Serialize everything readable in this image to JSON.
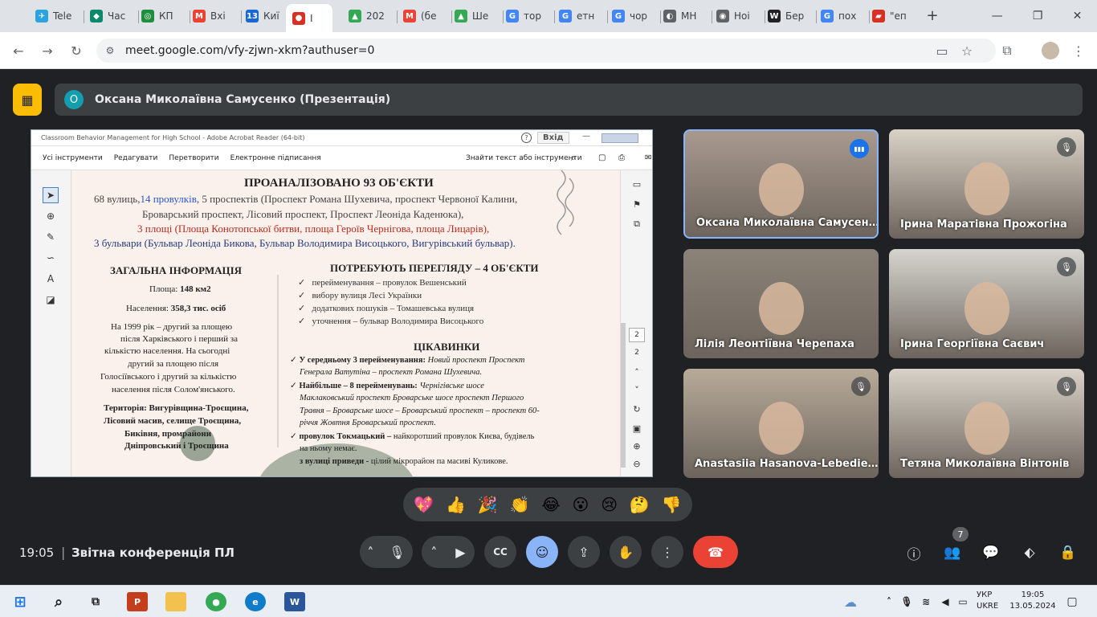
{
  "browser": {
    "tabs": [
      {
        "label": "Tele",
        "color": "#2aa3de",
        "glyph": "✈"
      },
      {
        "label": "Час",
        "color": "#0a8a6a",
        "glyph": "◆"
      },
      {
        "label": "КП",
        "color": "#1e8e3e",
        "glyph": "◎"
      },
      {
        "label": "Вхі",
        "color": "#ea4335",
        "glyph": "M"
      },
      {
        "label": "Киї",
        "color": "#1967d2",
        "glyph": "13"
      },
      {
        "label": "Ⅰ",
        "color": "#d93025",
        "glyph": "●"
      },
      {
        "label": "202",
        "color": "#34a853",
        "glyph": "▲"
      },
      {
        "label": "(бе",
        "color": "#ea4335",
        "glyph": "M"
      },
      {
        "label": "Ше",
        "color": "#34a853",
        "glyph": "▲"
      },
      {
        "label": "тор",
        "color": "#4285f4",
        "glyph": "G"
      },
      {
        "label": "етн",
        "color": "#4285f4",
        "glyph": "G"
      },
      {
        "label": "чор",
        "color": "#4285f4",
        "glyph": "G"
      },
      {
        "label": "МН",
        "color": "#5f6368",
        "glyph": "◐"
      },
      {
        "label": "Ноі",
        "color": "#5f6368",
        "glyph": "◉"
      },
      {
        "label": "Бер",
        "color": "#202124",
        "glyph": "W"
      },
      {
        "label": "пох",
        "color": "#4285f4",
        "glyph": "G"
      },
      {
        "label": "\"еп",
        "color": "#d93025",
        "glyph": "▰"
      }
    ],
    "url": "meet.google.com/vfy-zjwn-xkm?authuser=0"
  },
  "meet": {
    "presenter_initial": "О",
    "presenter": "Оксана Миколаївна Самусенко (Презентація)",
    "clock": "19:05",
    "separator": "|",
    "conference_name": "Звітна конференція ПЛ",
    "participants_count": "7",
    "participants": [
      {
        "name": "Оксана Миколаївна Самусен…",
        "bg": "#a8998e"
      },
      {
        "name": "Ірина Маратівна Прожогіна",
        "bg": "#d9d2c6"
      },
      {
        "name": "Лілія Леонтіївна Черепаха",
        "bg": "#8b8278"
      },
      {
        "name": "Ірина Георгіївна Саєвич",
        "bg": "#d6d4cf"
      },
      {
        "name": "Anastasiia Hasanova-Lebedie…",
        "bg": "#b7aa98"
      },
      {
        "name": "Тетяна Миколаївна Вінтонів",
        "bg": "#d8d2c8"
      }
    ],
    "reactions": [
      "💖",
      "👍",
      "🎉",
      "👏",
      "😂",
      "😮",
      "😢",
      "🤔",
      "👎"
    ]
  },
  "acrobat": {
    "title": "Classroom Behavior Management for High School - Adobe Acrobat Reader (64-bit)",
    "help": "?",
    "signin": "Вхід",
    "menu": [
      "Усі інструменти",
      "Редагувати",
      "Перетворити",
      "Електронне підписання"
    ],
    "search": "Знайти текст або інструменти",
    "page_num": "2",
    "page_total": "2"
  },
  "slide": {
    "heading": "ПРОАНАЛІЗОВАНО 93 ОБ'ЄКТИ",
    "line1a": "68 вулиць,",
    "line1b": "14 провулків",
    "line1c": ", 5 проспектів (Проспект Романа Шухевича,  проспект Червоної Калини,",
    "line2": "Броварський проспект, Лісовий проспект, Проспект Леоніда Каденюка),",
    "line3": "3 площі (Площа Конотопської битви, площа Героїв Чернігова, площа Лицарів),",
    "line4": "3 бульвари (Бульвар Леоніда Бикова, Бульвар Володимира Висоцького, Вигурівський бульвар).",
    "general_title": "ЗАГАЛЬНА ІНФОРМАЦІЯ",
    "area_label": "Площа: ",
    "area": "148 км2",
    "pop_label": "Населення: ",
    "pop": "358,3 тис. осіб",
    "g1": "На 1999 рік – другий за площею",
    "g2": "після Харківського і перший за",
    "g3": "кількістю населення. На сьогодні",
    "g4": "другий за площею після",
    "g5": "Голосіївського і другий за кількістю",
    "g6": "населення після Солом'янського.",
    "t1": "Територія: Вигурівщина-Троєщина,",
    "t2": "Лісовий масив, селище Троєщина,",
    "t3": "Биківня, промрайони",
    "t4": "Дніпровський і Троєщина",
    "review_title": "ПОТРЕБУЮТЬ ПЕРЕГЛЯДУ – 4 ОБ'ЄКТИ",
    "r1": "перейменування – провулок Вешенський",
    "r2": "вибору    вулиця Лесі Українки",
    "r3": "додаткових пошуків – Томашевська вулиця",
    "r4": "уточнення – бульвар Володимира Висоцького",
    "facts_title": "ЦІКАВИНКИ",
    "f1a": "У середньому 3 перейменування: ",
    "f1b": "Новий проспект     Проспект",
    "f1c": "Генерала Ватутіна –  проспект Романа Шухевича.",
    "f2a": "Найбільше   –   8   перейменувань: ",
    "f2b": "Чернігівське    шосе",
    "f2c": "Маклаковський проспект    Броварське шосе    проспект Першого",
    "f2d": "Травня – Броварське шосе –  Броварський проспект – проспект 60-",
    "f2e": "річчя Жовтня    Броварський проспект.",
    "f3a": "провулок Токмацький – ",
    "f3b": "  найкоротший провулок Києва, будівель",
    "f3c": "на ньому немає.",
    "f4a": "з вулиці приведи - ",
    "f4b": "цілий мікрорайон па масиві Куликове."
  },
  "taskbar": {
    "lang1": "УКР",
    "lang2": "UKRE",
    "time": "19:05",
    "date": "13.05.2024"
  },
  "colors": {
    "accent": "#8ab4f8",
    "end_call": "#ea4335",
    "presentation_badge": "#fbbc04"
  }
}
